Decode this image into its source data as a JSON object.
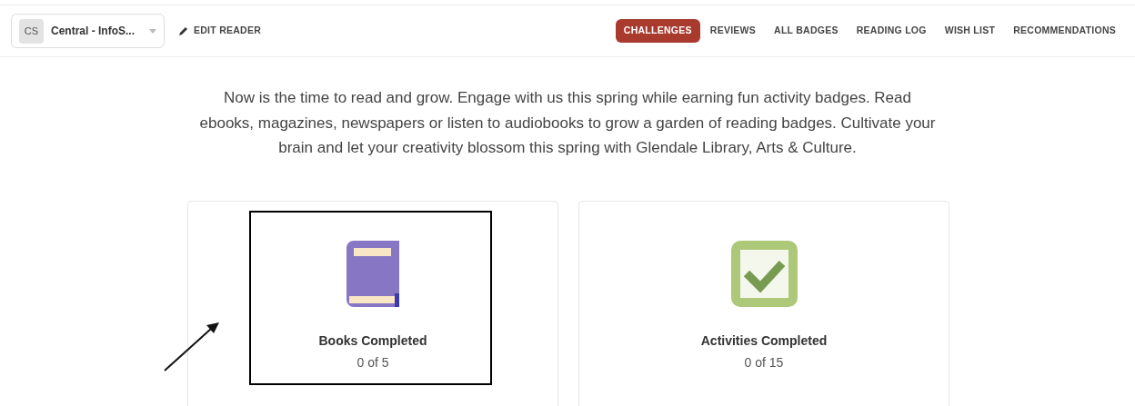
{
  "reader": {
    "initials": "CS",
    "name": "Central - InfoS..."
  },
  "edit_reader": "EDIT READER",
  "tabs": [
    {
      "label": "CHALLENGES",
      "selected": true
    },
    {
      "label": "REVIEWS",
      "selected": false
    },
    {
      "label": "ALL BADGES",
      "selected": false
    },
    {
      "label": "READING LOG",
      "selected": false
    },
    {
      "label": "WISH LIST",
      "selected": false
    },
    {
      "label": "RECOMMENDATIONS",
      "selected": false
    }
  ],
  "intro": "Now is the time to read and grow. Engage with us this spring while earning fun activity badges. Read ebooks, magazines, newspapers or listen to audiobooks to grow a garden of reading badges. Cultivate your brain and let your creativity blossom this spring with Glendale Library, Arts & Culture.",
  "cards": [
    {
      "kind": "books",
      "title": "Books Completed",
      "progress": "0 of 5",
      "highlighted": true
    },
    {
      "kind": "activities",
      "title": "Activities Completed",
      "progress": "0 of 15",
      "highlighted": false
    }
  ]
}
